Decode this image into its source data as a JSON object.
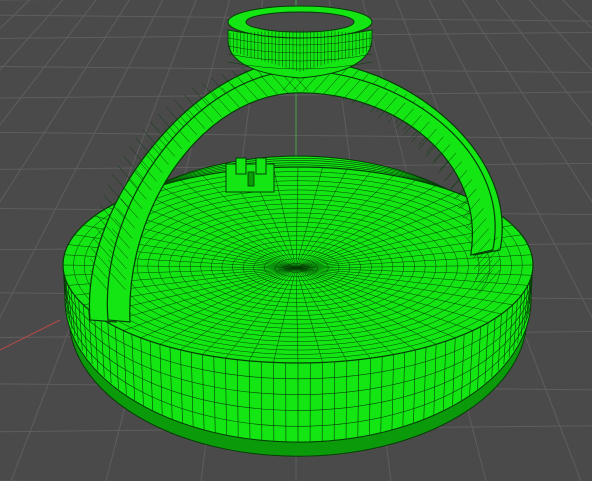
{
  "viewport": {
    "background": "#4a4a4a",
    "grid_color": "#5e5e5e",
    "axis_green": "#3fa64a",
    "axis_red": "#b84848"
  },
  "model": {
    "fill_color": "#13e613",
    "wire_color": "#063d06",
    "shadow_color": "#0a9a0a"
  }
}
